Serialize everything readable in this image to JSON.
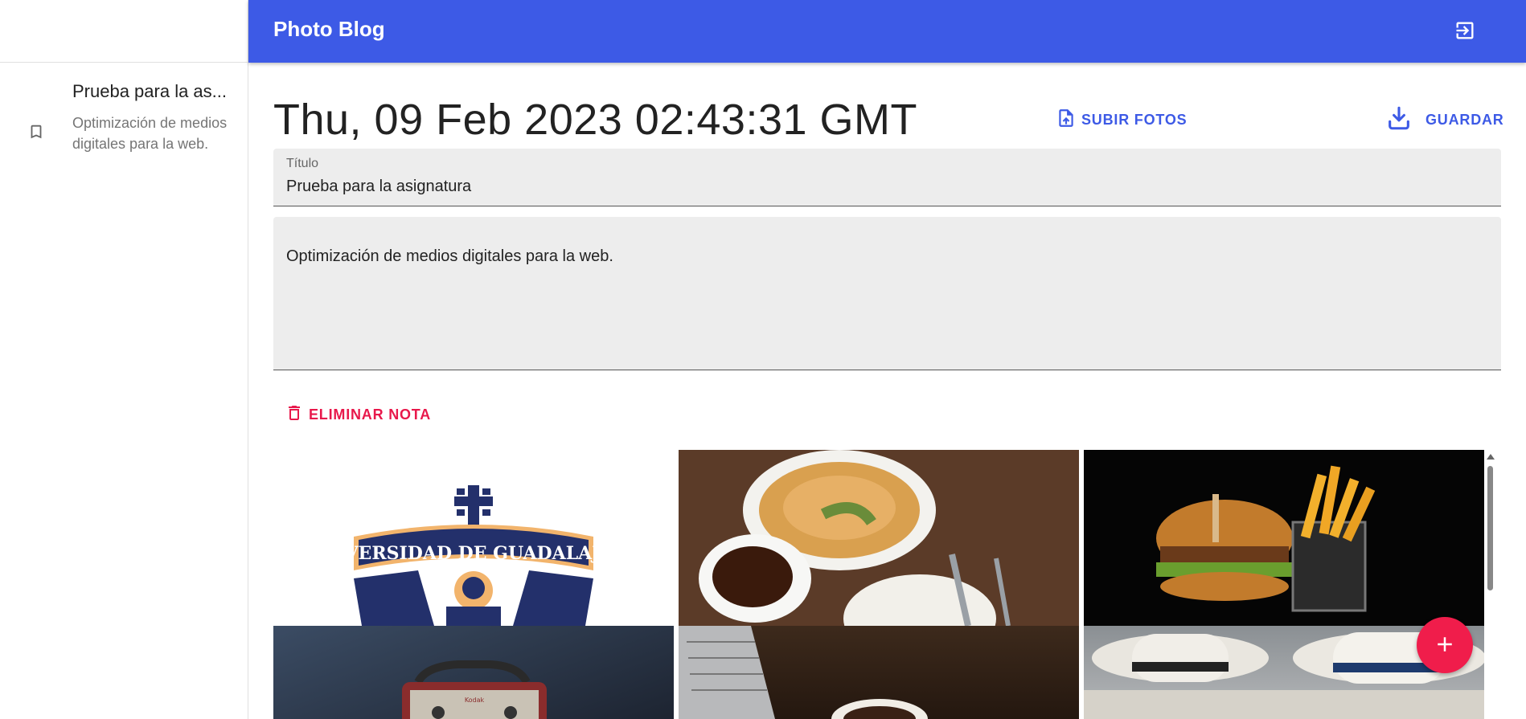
{
  "app": {
    "title": "Photo Blog"
  },
  "sidebar": {
    "notes": [
      {
        "title": "Prueba para la as...",
        "description": "Optimización de medios digitales para la web."
      }
    ]
  },
  "toolbar": {
    "upload_label": "SUBIR FOTOS",
    "save_label": "GUARDAR",
    "delete_label": "ELIMINAR NOTA"
  },
  "note": {
    "date": "Thu, 09 Feb 2023 02:43:31 GMT",
    "title_label": "Título",
    "title_value": "Prueba para la asignatura",
    "body_value": "Optimización de medios digitales para la web."
  },
  "gallery": {
    "logo_text": "UNIVERSIDAD DE GUADALAJARA",
    "radio_brand": "Kodak"
  },
  "colors": {
    "primary": "#3d5ae6",
    "danger": "#e8184b",
    "fab": "#f01d4b"
  },
  "icons": [
    "bookmark-icon",
    "logout-icon",
    "file-upload-icon",
    "download-icon",
    "trash-icon",
    "plus-icon"
  ]
}
